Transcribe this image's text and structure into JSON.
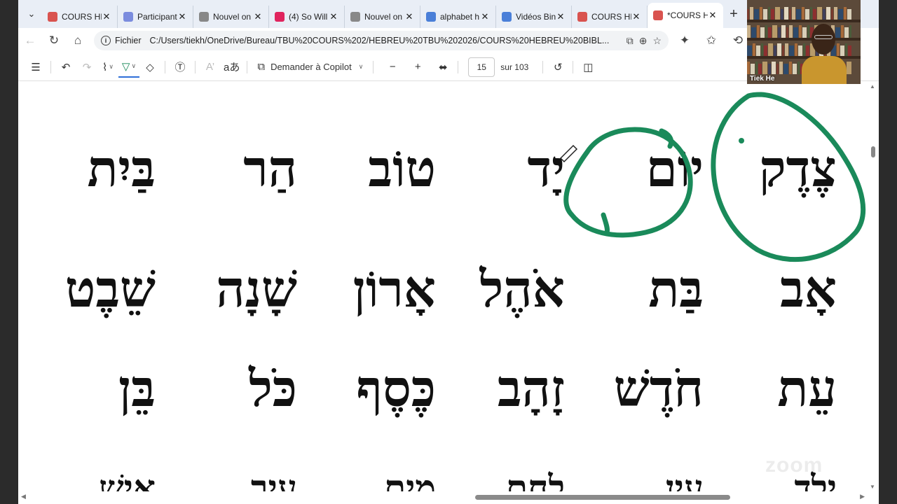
{
  "tabs": [
    {
      "label": "COURS HE",
      "icon": "pdf-icon",
      "color": "#d9534f"
    },
    {
      "label": "Participant",
      "icon": "zoom-icon",
      "color": "#7b8cde"
    },
    {
      "label": "Nouvel on",
      "icon": "page-icon",
      "color": "#888888"
    },
    {
      "label": "(4) So Will",
      "icon": "youtube-icon",
      "color": "#e0245e"
    },
    {
      "label": "Nouvel on",
      "icon": "page-icon",
      "color": "#888888"
    },
    {
      "label": "alphabet h",
      "icon": "search-icon",
      "color": "#4a7fd8"
    },
    {
      "label": "Vidéos Bin",
      "icon": "search-icon",
      "color": "#4a7fd8"
    },
    {
      "label": "COURS HE",
      "icon": "pdf-icon",
      "color": "#d9534f"
    },
    {
      "label": "*COURS HE",
      "icon": "pdf-icon",
      "color": "#d9534f",
      "active": true
    }
  ],
  "address": {
    "scheme": "Fichier",
    "url": "C:/Users/tiekh/OneDrive/Bureau/TBU%20COURS%202/HEBREU%20TBU%202026/COURS%20HEBREU%20BIBL..."
  },
  "pdf_toolbar": {
    "copilot_label": "Demander à Copilot",
    "page_current": "15",
    "page_total": "sur 103",
    "read_aloud_glyph": "aあ"
  },
  "document": {
    "rows": [
      [
        "צֶדֶק",
        "יוֹם",
        "יָד",
        "טוֹב",
        "הַר",
        "בַּיִת"
      ],
      [
        "אָב",
        "בַּת",
        "אֹהֶל",
        "אָרוֹן",
        "שָׁנָה",
        "שֵׁבֶט"
      ],
      [
        "עֵת",
        "חֹדֶשׁ",
        "זָהָב",
        "כֶּסֶף",
        "כֹּל",
        "בֵּן"
      ],
      [
        "יֶלֶד",
        "עַיִן",
        "לֶחֶם",
        "מַיִם",
        "עִיר",
        "אִישׁ"
      ]
    ],
    "annotation_color": "#1a8a5a"
  },
  "webcam": {
    "name": "Tiek He"
  },
  "watermark": "zoom"
}
